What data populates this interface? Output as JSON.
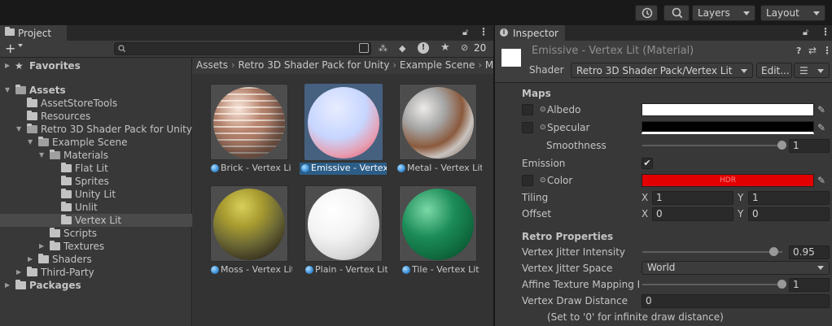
{
  "toolbar": {
    "history_icon": "history-icon",
    "search_icon": "search-icon",
    "layers_label": "Layers",
    "layout_label": "Layout"
  },
  "project": {
    "tab_label": "Project",
    "add_label": "+",
    "search_placeholder": "",
    "hidden_count": "20",
    "tree": [
      {
        "label": "Favorites",
        "bold": true
      },
      {
        "label": "Assets",
        "bold": true
      },
      {
        "label": "AssetStoreTools"
      },
      {
        "label": "Resources"
      },
      {
        "label": "Retro 3D Shader Pack for Unity"
      },
      {
        "label": "Example Scene"
      },
      {
        "label": "Materials"
      },
      {
        "label": "Flat Lit"
      },
      {
        "label": "Sprites"
      },
      {
        "label": "Unity Lit"
      },
      {
        "label": "Unlit"
      },
      {
        "label": "Vertex Lit"
      },
      {
        "label": "Scripts"
      },
      {
        "label": "Textures"
      },
      {
        "label": "Shaders"
      },
      {
        "label": "Third-Party"
      },
      {
        "label": "Packages",
        "bold": true
      }
    ],
    "breadcrumb": [
      "Assets",
      "Retro 3D Shader Pack for Unity",
      "Example Scene",
      "M"
    ],
    "assets": [
      {
        "label": "Brick - Vertex Lit"
      },
      {
        "label": "Emissive - Vertex..."
      },
      {
        "label": "Metal - Vertex Lit"
      },
      {
        "label": "Moss - Vertex Lit"
      },
      {
        "label": "Plain - Vertex Lit"
      },
      {
        "label": "Tile - Vertex Lit"
      }
    ]
  },
  "inspector": {
    "tab_label": "Inspector",
    "title": "Emissive - Vertex Lit (Material)",
    "shader_label": "Shader",
    "shader_value": "Retro 3D Shader Pack/Vertex Lit",
    "edit_label": "Edit...",
    "maps_header": "Maps",
    "albedo_label": "Albedo",
    "specular_label": "Specular",
    "smoothness_label": "Smoothness",
    "smoothness_value": "1",
    "emission_label": "Emission",
    "emission_checked": true,
    "color_label": "Color",
    "hdr_label": "HDR",
    "tiling_label": "Tiling",
    "tiling_x": "1",
    "tiling_y": "1",
    "offset_label": "Offset",
    "offset_x": "0",
    "offset_y": "0",
    "x_label": "X",
    "y_label": "Y",
    "retro_header": "Retro Properties",
    "jitter_intensity_label": "Vertex Jitter Intensity",
    "jitter_intensity_value": "0.95",
    "jitter_space_label": "Vertex Jitter Space",
    "jitter_space_value": "World",
    "affine_label": "Affine Texture Mapping In",
    "affine_value": "1",
    "draw_distance_label": "Vertex Draw Distance",
    "draw_distance_value": "0",
    "draw_distance_hint": "(Set to '0' for infinite draw distance)"
  },
  "colors": {
    "accent": "#2c5d87",
    "emission": "#e30000",
    "panel": "#383838"
  }
}
